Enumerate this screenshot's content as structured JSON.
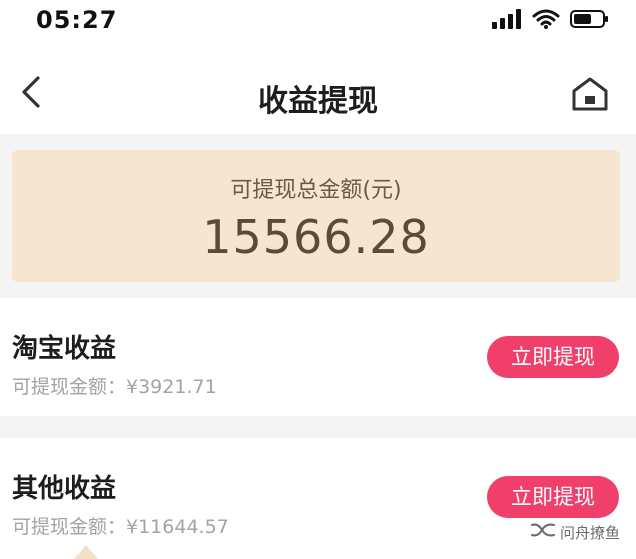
{
  "status_bar": {
    "time": "05:27",
    "icons": [
      "signal-icon",
      "wifi-icon",
      "battery-icon"
    ]
  },
  "nav": {
    "title": "收益提现",
    "back_icon": "chevron-left-icon",
    "home_icon": "home-icon"
  },
  "summary": {
    "label": "可提现总金额(元)",
    "amount": "15566.28"
  },
  "incomes": [
    {
      "name": "淘宝收益",
      "sub": "可提现金额：¥3921.71",
      "button": "立即提现"
    },
    {
      "name": "其他收益",
      "sub": "可提现金额：¥11644.57",
      "button": "立即提现"
    }
  ],
  "watermark": {
    "text": "问舟撩鱼",
    "icon": "wechat-channel-icon"
  },
  "colors": {
    "accent": "#ef3f6a",
    "card_bg": "#f6e6cf",
    "amount_text": "#5f4a38"
  }
}
